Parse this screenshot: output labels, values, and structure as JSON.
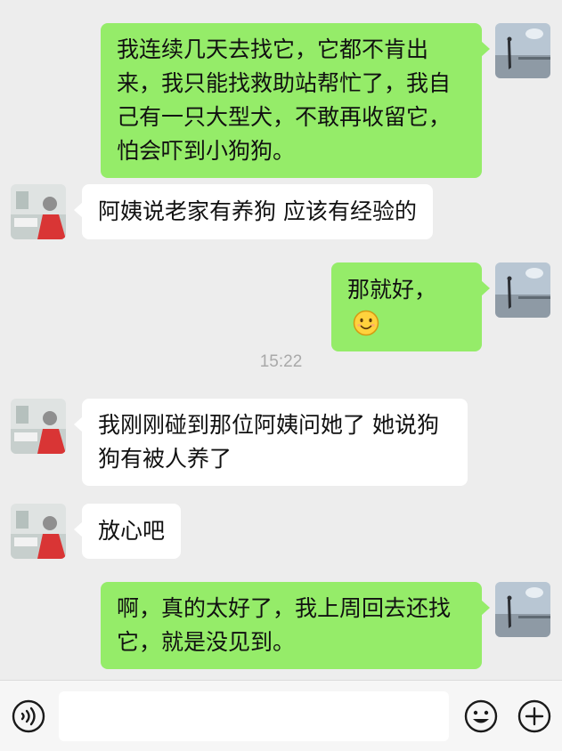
{
  "timestamp": "15:22",
  "messages": [
    {
      "side": "out",
      "text": "我连续几天去找它，它都不肯出来，我只能找救助站帮忙了，我自己有一只大型犬，不敢再收留它，怕会吓到小狗狗。"
    },
    {
      "side": "in",
      "text": "阿姨说老家有养狗 应该有经验的"
    },
    {
      "side": "out",
      "text": "那就好，",
      "emoji": "smiling-face-emoji"
    },
    {
      "side": "in",
      "text": "我刚刚碰到那位阿姨问她了 她说狗狗有被人养了"
    },
    {
      "side": "in",
      "text": "放心吧"
    },
    {
      "side": "out",
      "text": "啊，真的太好了，我上周回去还找它，就是没见到。"
    }
  ],
  "input_bar": {
    "voice_icon": "voice-icon",
    "text_value": "",
    "emoji_icon": "emoji-icon",
    "add_icon": "plus-icon"
  },
  "colors": {
    "background": "#ededed",
    "outgoing_bubble": "#95ec69",
    "incoming_bubble": "#ffffff",
    "timestamp": "#a9a9a9"
  }
}
